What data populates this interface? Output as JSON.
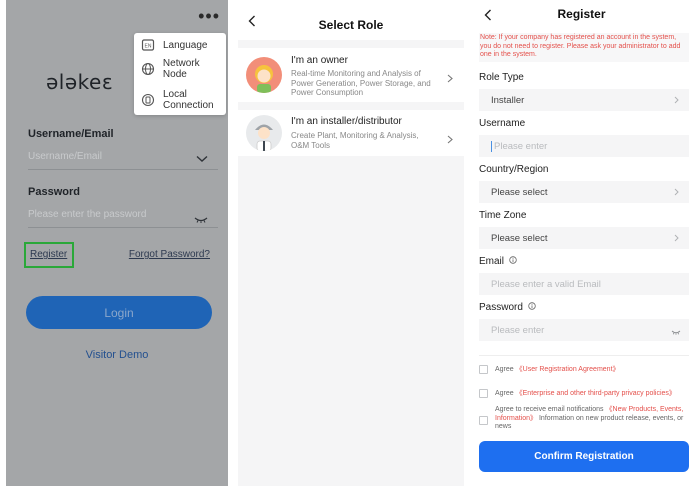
{
  "login": {
    "more_glyph": "•••",
    "logo_text": "ələkeɛ",
    "menu": [
      {
        "label": "Language",
        "icon": "language-icon"
      },
      {
        "label": "Network Node",
        "icon": "globe-icon"
      },
      {
        "label_line1": "Local",
        "label_line2": "Connection",
        "icon": "device-icon"
      }
    ],
    "username_label": "Username/Email",
    "username_placeholder": "Username/Email",
    "password_label": "Password",
    "password_placeholder": "Please enter the password",
    "register_link": "Register",
    "forgot_link": "Forgot Password?",
    "login_button": "Login",
    "visitor_demo": "Visitor Demo",
    "highlight_color": "#2aa839",
    "primary_color": "#1f64b6"
  },
  "select_role": {
    "title": "Select Role",
    "roles": [
      {
        "title": "I'm an owner",
        "desc": "Real-time Monitoring and Analysis of Power Generation, Power Storage, and Power Consumption",
        "avatar": "owner-avatar-icon"
      },
      {
        "title": "I'm an installer/distributor",
        "desc": "Create Plant, Monitoring & Analysis, O&M Tools",
        "avatar": "installer-avatar-icon"
      }
    ]
  },
  "register": {
    "title": "Register",
    "note": "Note: If your company has registered an account in the system, you do not need to register. Please ask your administrator to add one in the system.",
    "role_type_label": "Role Type",
    "role_type_value": "Installer",
    "username_label": "Username",
    "username_placeholder": "Please enter",
    "country_label": "Country/Region",
    "country_value": "Please select",
    "timezone_label": "Time Zone",
    "timezone_value": "Please select",
    "email_label": "Email",
    "email_placeholder": "Please enter a valid Email",
    "password_label": "Password",
    "password_placeholder": "Please enter",
    "agree1_prefix": "Agree",
    "agree1_link": "《User Registration Agreement》",
    "agree2_prefix": "Agree",
    "agree2_link": "《Enterprise and other third-party privacy policies》",
    "agree3_prefix": "Agree to receive email notifications",
    "agree3_link": "《New Products, Events, Information》",
    "agree3_suffix": "Information on new product release, events, or news",
    "confirm_button": "Confirm Registration",
    "accent_color": "#1e6ff0",
    "note_color": "#e4504b"
  }
}
